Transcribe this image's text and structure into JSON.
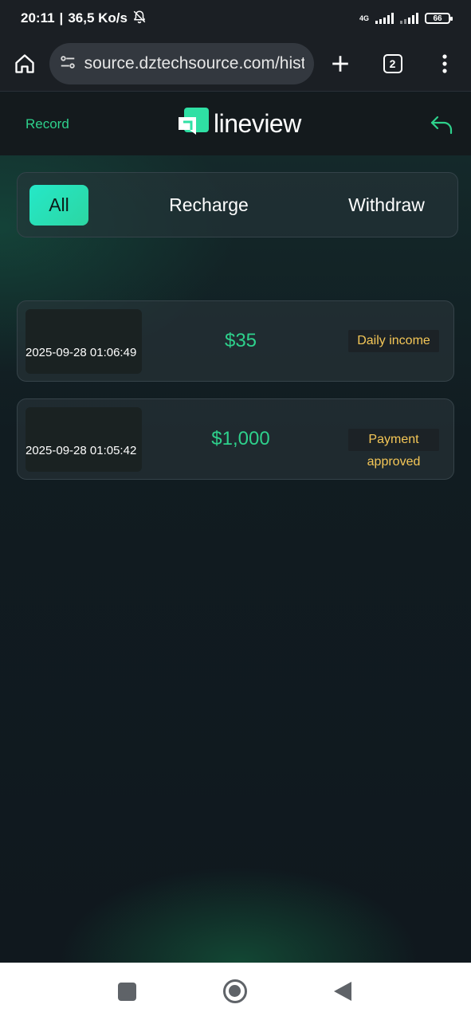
{
  "status_bar": {
    "time": "20:11",
    "separator": "|",
    "net_speed": "36,5 Ko/s",
    "network_type": "4G",
    "battery": "66"
  },
  "browser": {
    "url": "source.dztechsource.com/history",
    "tab_count": "2"
  },
  "header": {
    "record_label": "Record",
    "logo_text": "lineview"
  },
  "tabs": [
    {
      "label": "All",
      "active": true
    },
    {
      "label": "Recharge",
      "active": false
    },
    {
      "label": "Withdraw",
      "active": false
    }
  ],
  "records": [
    {
      "date": "2025-09-28 01:06:49",
      "amount": "$35",
      "status": "Daily income",
      "status_line2": ""
    },
    {
      "date": "2025-09-28 01:05:42",
      "amount": "$1,000",
      "status": "Payment",
      "status_line2": "approved"
    }
  ],
  "colors": {
    "accent_green": "#2ed18c",
    "status_yellow": "#f5c757",
    "tab_active_start": "#25e8c8",
    "tab_active_end": "#2cd6a2"
  }
}
